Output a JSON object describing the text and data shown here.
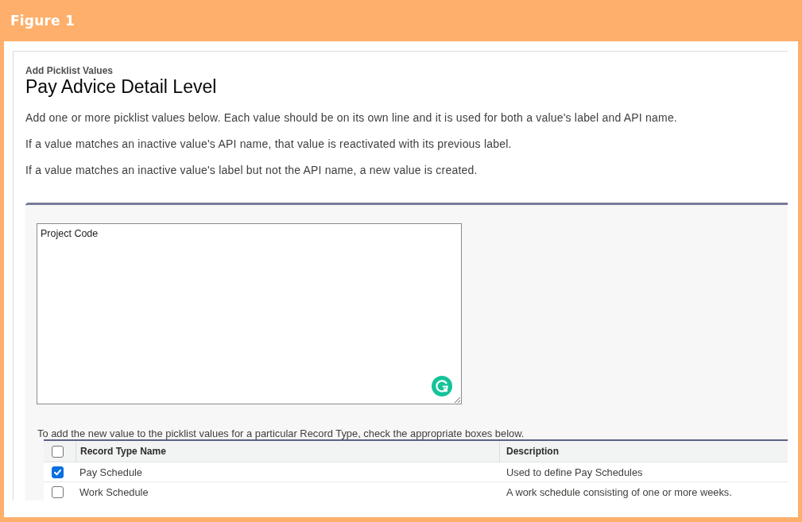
{
  "figure": {
    "title": "Figure 1"
  },
  "page": {
    "eyebrow": "Add Picklist Values",
    "title": "Pay Advice Detail Level",
    "paragraphs": [
      "Add one or more picklist values below. Each value should be on its own line and it is used for both a value's label and API name.",
      "If a value matches an inactive value's API name, that value is reactivated with its previous label.",
      "If a value matches an inactive value's label but not the API name, a new value is created."
    ]
  },
  "form": {
    "values_field": {
      "value": "Project Code"
    },
    "record_type_hint": "To add the new value to the picklist values for a particular Record Type, check the appropriate boxes below.",
    "table": {
      "select_all": {
        "checked": false
      },
      "columns": [
        "Record Type Name",
        "Description"
      ],
      "rows": [
        {
          "name": "Pay Schedule",
          "description": "Used to define Pay Schedules",
          "checked": true
        },
        {
          "name": "Work Schedule",
          "description": "A work schedule consisting of one or more weeks.",
          "checked": false
        }
      ]
    }
  }
}
